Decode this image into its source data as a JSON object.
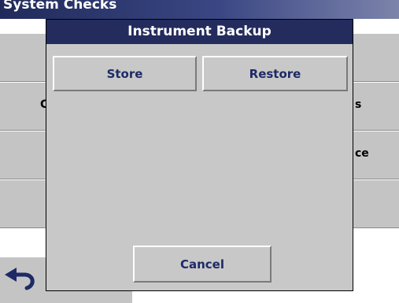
{
  "window": {
    "title": "System Checks"
  },
  "background": {
    "row2_left_fragment": "C",
    "row2_right_fragment": "s",
    "row3_right_fragment": "ce"
  },
  "dialog": {
    "title": "Instrument Backup",
    "store_label": "Store",
    "restore_label": "Restore",
    "cancel_label": "Cancel"
  },
  "icons": {
    "back": "back-arrow-icon"
  }
}
